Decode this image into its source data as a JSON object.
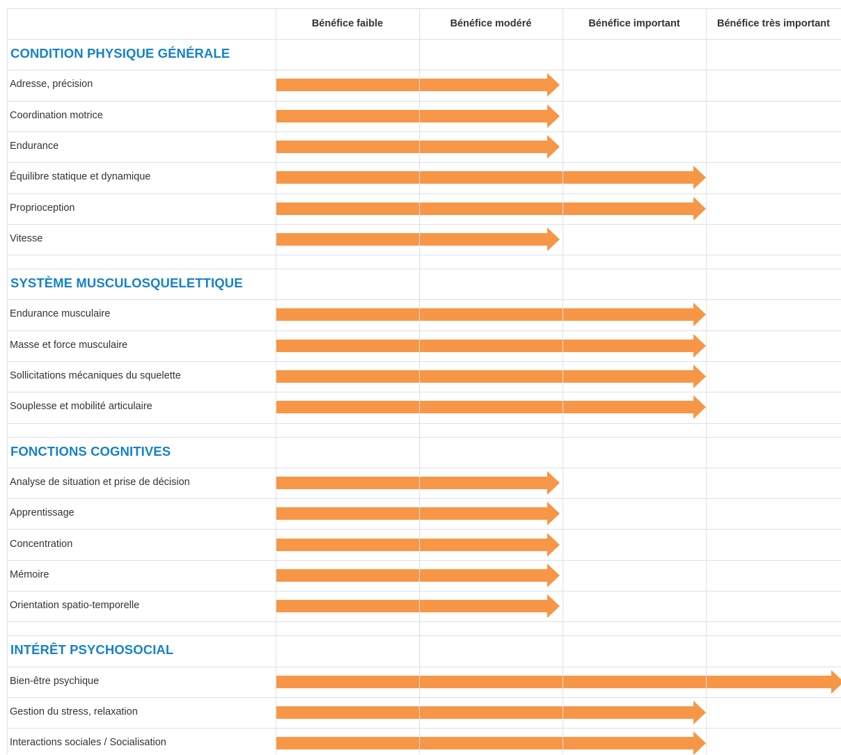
{
  "arrow_color": "#f79646",
  "section_title_color": "#1582c9",
  "columns": [
    "Bénéfice faible",
    "Bénéfice modéré",
    "Bénéfice important",
    "Bénéfice très important"
  ],
  "sections": [
    {
      "title": "CONDITION PHYSIQUE GÉNÉRALE",
      "rows": [
        {
          "label": "Adresse, précision",
          "level": 2
        },
        {
          "label": "Coordination motrice",
          "level": 2
        },
        {
          "label": "Endurance",
          "level": 2
        },
        {
          "label": "Équilibre statique et dynamique",
          "level": 3
        },
        {
          "label": "Proprioception",
          "level": 3
        },
        {
          "label": "Vitesse",
          "level": 2
        }
      ]
    },
    {
      "title": "SYSTÈME MUSCULOSQUELETTIQUE",
      "rows": [
        {
          "label": "Endurance musculaire",
          "level": 3
        },
        {
          "label": "Masse et force musculaire",
          "level": 3
        },
        {
          "label": "Sollicitations mécaniques du squelette",
          "level": 3
        },
        {
          "label": "Souplesse et mobilité articulaire",
          "level": 3
        }
      ]
    },
    {
      "title": "FONCTIONS COGNITIVES",
      "rows": [
        {
          "label": "Analyse de situation et prise de décision",
          "level": 2
        },
        {
          "label": "Apprentissage",
          "level": 2
        },
        {
          "label": "Concentration",
          "level": 2
        },
        {
          "label": "Mémoire",
          "level": 2
        },
        {
          "label": "Orientation spatio-temporelle",
          "level": 2
        }
      ]
    },
    {
      "title": "INTÉRÊT PSYCHOSOCIAL",
      "rows": [
        {
          "label": "Bien-être psychique",
          "level": 4
        },
        {
          "label": "Gestion du stress, relaxation",
          "level": 3
        },
        {
          "label": "Interactions sociales / Socialisation",
          "level": 3
        }
      ]
    }
  ]
}
